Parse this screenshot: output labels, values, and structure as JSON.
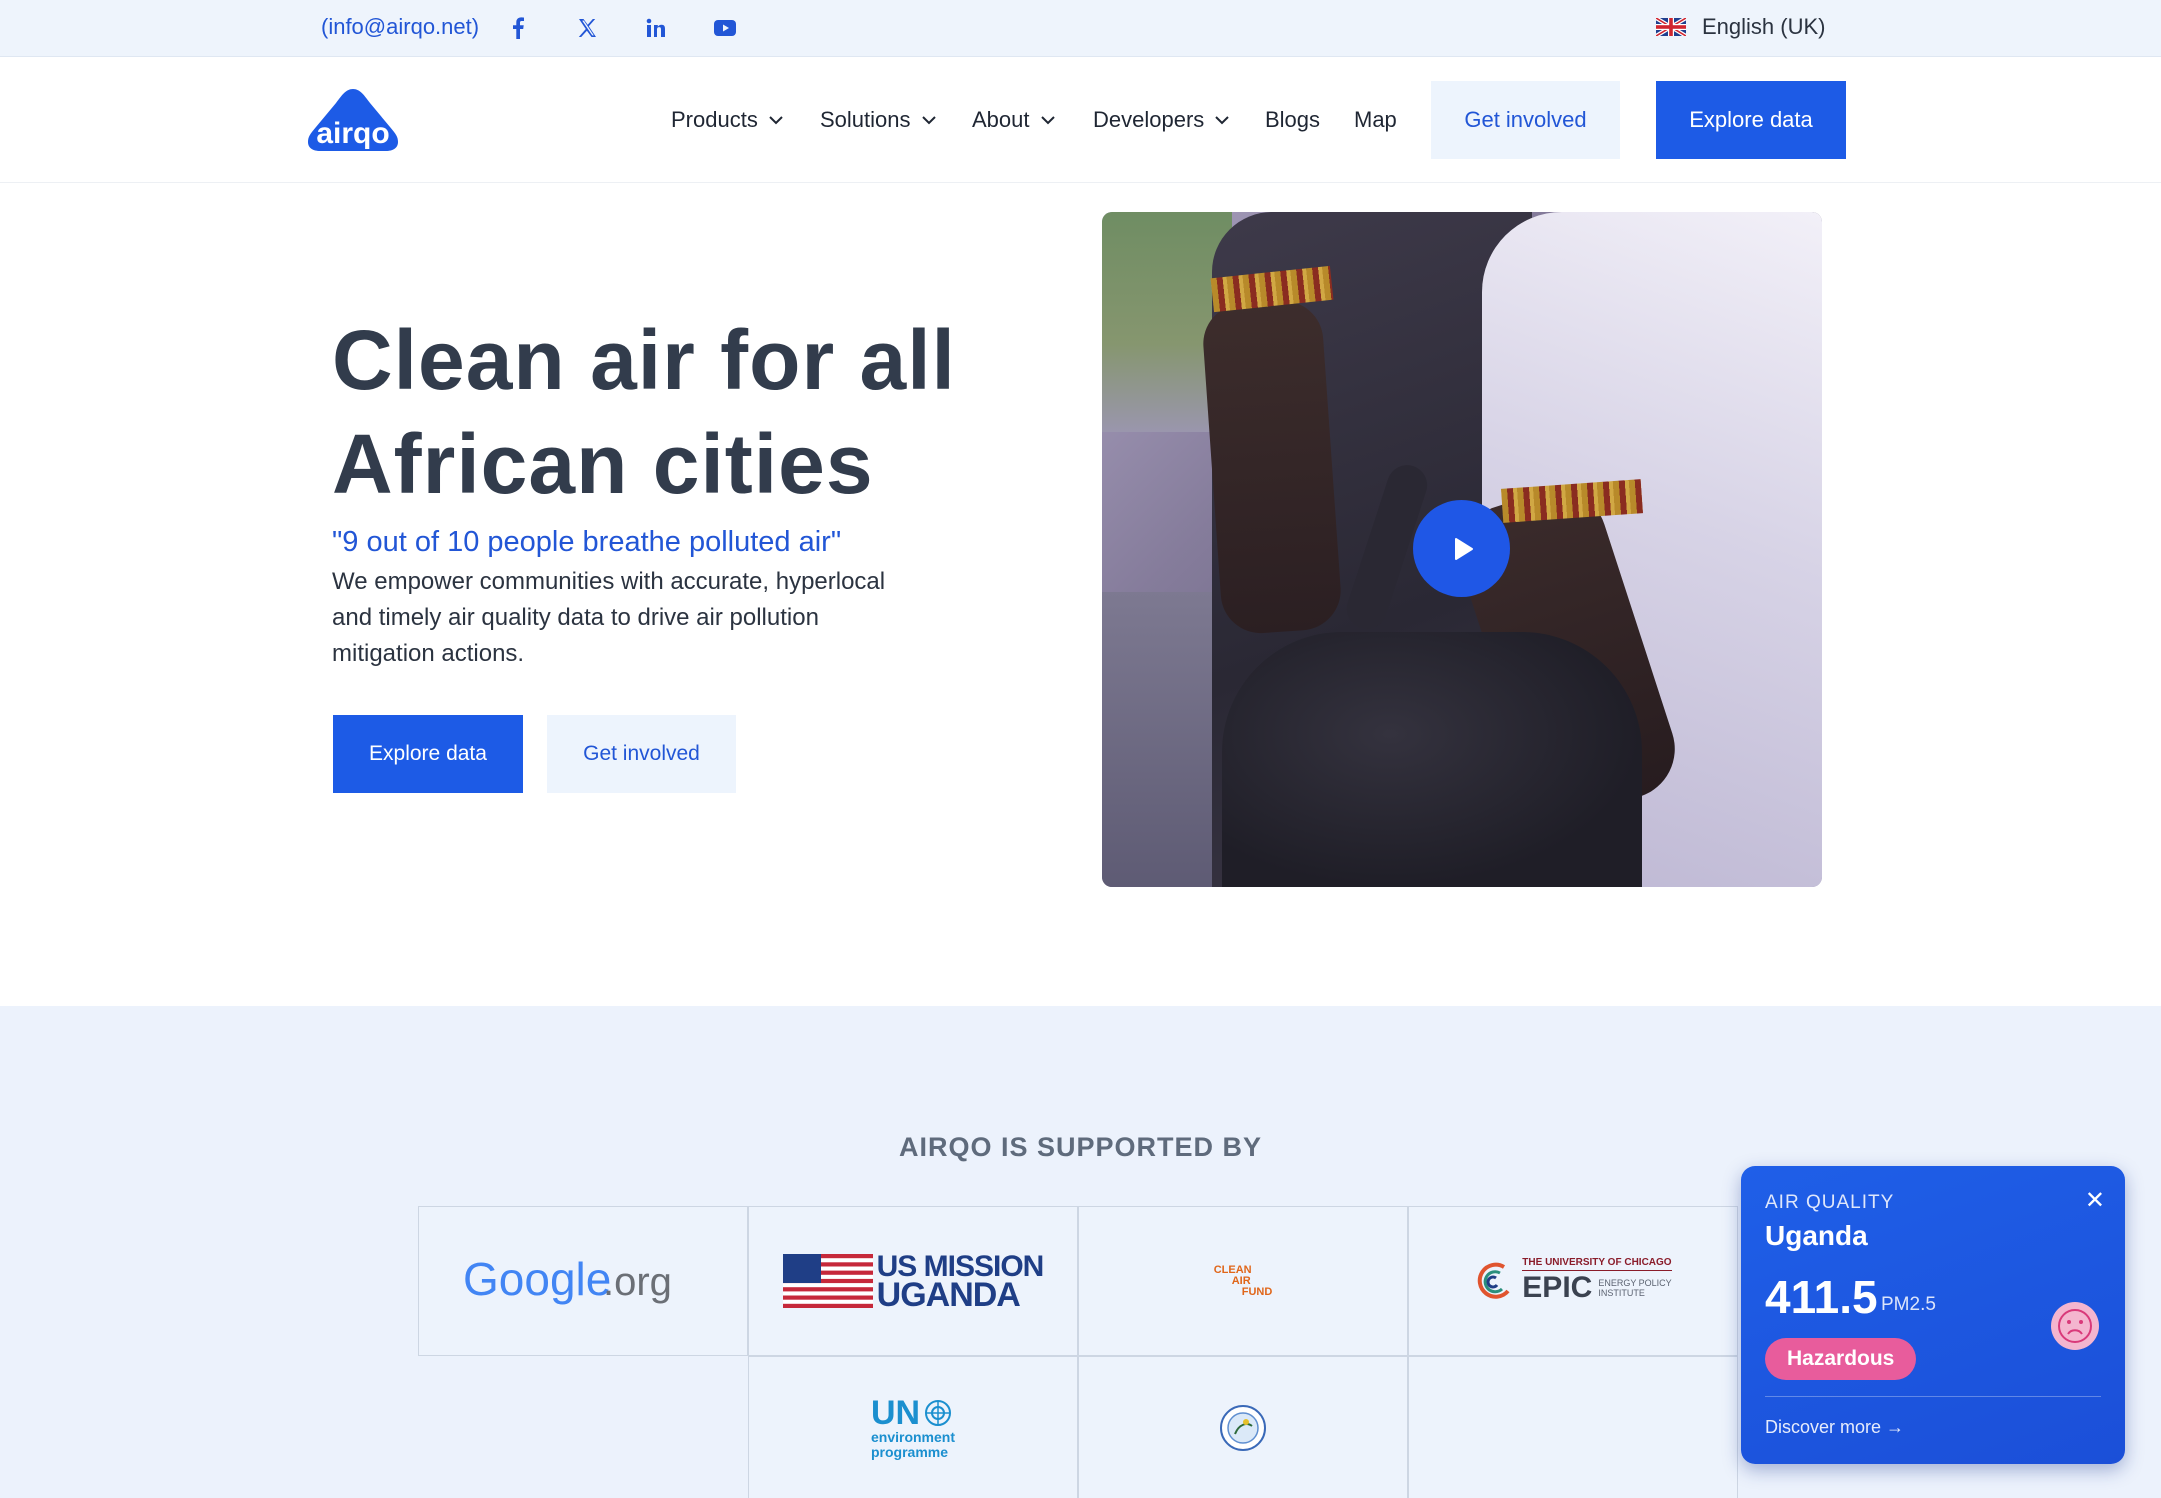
{
  "topbar": {
    "email": "(info@airqo.net)",
    "social": [
      "facebook-icon",
      "x-icon",
      "linkedin-icon",
      "youtube-icon"
    ],
    "language": "English (UK)"
  },
  "header": {
    "logo_text": "airqo",
    "nav": [
      {
        "label": "Products",
        "has_dropdown": true
      },
      {
        "label": "Solutions",
        "has_dropdown": true
      },
      {
        "label": "About",
        "has_dropdown": true
      },
      {
        "label": "Developers",
        "has_dropdown": true
      },
      {
        "label": "Blogs",
        "has_dropdown": false
      },
      {
        "label": "Map",
        "has_dropdown": false
      }
    ],
    "get_involved": "Get involved",
    "explore_data": "Explore data"
  },
  "hero": {
    "title_line1": "Clean air for all",
    "title_line2": "African cities",
    "quote": "\"9 out of 10 people breathe polluted air\"",
    "description": "We empower communities with accurate, hyperlocal and timely air quality data to drive air pollution mitigation actions.",
    "explore_data": "Explore data",
    "get_involved": "Get involved"
  },
  "supporters": {
    "title": "AIRQO IS SUPPORTED BY",
    "logos": {
      "google_g": "Google",
      "google_org": ".org",
      "us_mission_1": "US MISSION",
      "us_mission_2": "UGANDA",
      "caf_1": "CLEAN",
      "caf_2": "AIR",
      "caf_3": "FUND",
      "epic_top": "THE UNIVERSITY OF CHICAGO",
      "epic_main": "EPIC",
      "epic_sub1": "ENERGY POLICY",
      "epic_sub2": "INSTITUTE",
      "un_main": "UN",
      "un_sub1": "environment",
      "un_sub2": "programme"
    }
  },
  "air_quality": {
    "label": "AIR QUALITY",
    "country": "Uganda",
    "value": "411.5",
    "unit": "PM2.5",
    "category": "Hazardous",
    "link": "Discover more →",
    "colors": {
      "widget": "#1f5fe8",
      "badge": "#e85c9c"
    }
  },
  "colors": {
    "primary": "#1d5be6",
    "light_button": "#edf4fd",
    "heading": "#323c4c"
  }
}
